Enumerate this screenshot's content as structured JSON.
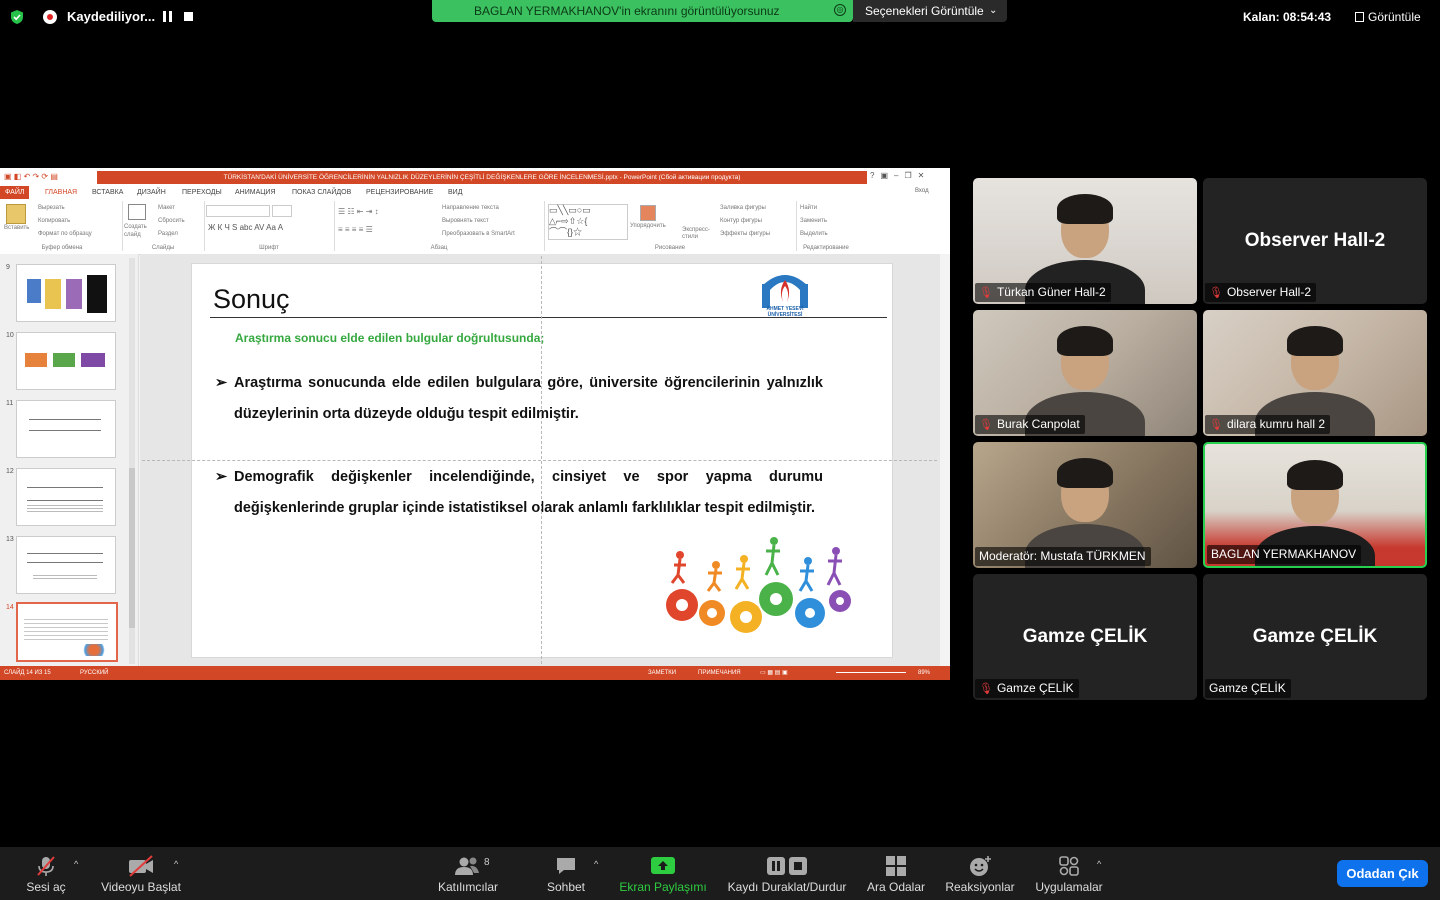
{
  "topbar": {
    "recording_label": "Kaydediliyor...",
    "share_banner": "BAGLAN YERMAKHANOV'in ekranını görüntülüyorsunuz",
    "view_options": "Seçenekleri Görüntüle",
    "time_left": "Kalan: 08:54:43",
    "view_label": "Görüntüle"
  },
  "ppt": {
    "window_title": "TÜRKİSTAN'DAKİ ÜNİVERSİTE ÖĞRENCİLERİNİN YALNIZLIK DÜZEYLERİNİN ÇEŞİTLİ DEĞİŞKENLERE GÖRE İNCELENMESİ.pptx - PowerPoint (Сбой активации продукта)",
    "login": "Вход",
    "tabs": [
      "ФАЙЛ",
      "ГЛАВНАЯ",
      "ВСТАВКА",
      "ДИЗАЙН",
      "ПЕРЕХОДЫ",
      "АНИМАЦИЯ",
      "ПОКАЗ СЛАЙДОВ",
      "РЕЦЕНЗИРОВАНИЕ",
      "ВИД"
    ],
    "ribbon": {
      "paste": "Вставить",
      "cut": "Вырезать",
      "copy": "Копировать",
      "format_painter": "Формат по образцу",
      "clipboard": "Буфер обмена",
      "new_slide": "Создать слайд",
      "layout": "Макет",
      "reset": "Сбросить",
      "section": "Раздел",
      "slides": "Слайды",
      "font": "Шрифт",
      "text_direction": "Направление текста",
      "align_text": "Выровнять текст",
      "smartart": "Преобразовать в SmartArt",
      "paragraph": "Абзац",
      "arrange": "Упорядочить",
      "quick_styles": "Экспресс-стили",
      "shape_fill": "Заливка фигуры",
      "shape_outline": "Контур фигуры",
      "shape_effects": "Эффекты фигуры",
      "drawing": "Рисование",
      "find": "Найти",
      "replace": "Заменить",
      "select": "Выделить",
      "editing": "Редактирование"
    },
    "thumbnails": [
      "9",
      "10",
      "11",
      "12",
      "13",
      "14"
    ],
    "slide": {
      "title": "Sonuç",
      "subtitle": "Araştırma sonucu elde edilen bulgular doğrultusunda;",
      "bullets": [
        "Araştırma sonucunda elde edilen bulgulara göre, üniversite öğrencilerinin yalnızlık düzeylerinin orta düzeyde olduğu tespit edilmiştir.",
        "Demografik değişkenler incelendiğinde, cinsiyet ve spor yapma durumu değişkenlerinde gruplar içinde istatistiksel olarak anlamlı farklılıklar tespit edilmiştir."
      ],
      "logo_text": "AHMET YESEVİ ÜNİVERSİTESİ"
    },
    "status": {
      "slide_of": "СЛАЙД 14 ИЗ 15",
      "language": "РУССКИЙ",
      "notes": "ЗАМЕТКИ",
      "comments": "ПРИМЕЧАНИЯ",
      "zoom": "89%"
    }
  },
  "participants": [
    {
      "name": "Türkan Güner Hall-2",
      "big": "",
      "muted": true,
      "video": "woman-dark"
    },
    {
      "name": "Observer Hall-2",
      "big": "Observer Hall-2",
      "muted": true,
      "video": ""
    },
    {
      "name": "Burak Canpolat",
      "big": "",
      "muted": true,
      "video": "man-beard"
    },
    {
      "name": "dilara kumru hall 2",
      "big": "",
      "muted": true,
      "video": "woman-glasses"
    },
    {
      "name": "Moderatör: Mustafa TÜRKMEN",
      "big": "",
      "muted": false,
      "video": "man-office"
    },
    {
      "name": "BAGLAN YERMAKHANOV",
      "big": "",
      "muted": false,
      "video": "man-red",
      "active": true
    },
    {
      "name": "Gamze ÇELİK",
      "big": "Gamze ÇELİK",
      "muted": true,
      "video": ""
    },
    {
      "name": "Gamze ÇELİK",
      "big": "Gamze ÇELİK",
      "muted": false,
      "video": ""
    }
  ],
  "toolbar": {
    "unmute": "Sesi aç",
    "start_video": "Videoyu Başlat",
    "participants": "Katılımcılar",
    "participants_count": "8",
    "chat": "Sohbet",
    "share_screen": "Ekran Paylaşımı",
    "pause_stop_recording": "Kaydı Duraklat/Durdur",
    "breakout_rooms": "Ara Odalar",
    "reactions": "Reaksiyonlar",
    "apps": "Uygulamalar",
    "leave": "Odadan Çık"
  },
  "colors": {
    "share_banner": "#3cc160",
    "ppt_accent": "#d24726",
    "leave_button": "#0e72ed",
    "active_speaker": "#27d14f",
    "slide_subtitle": "#35a83f"
  }
}
